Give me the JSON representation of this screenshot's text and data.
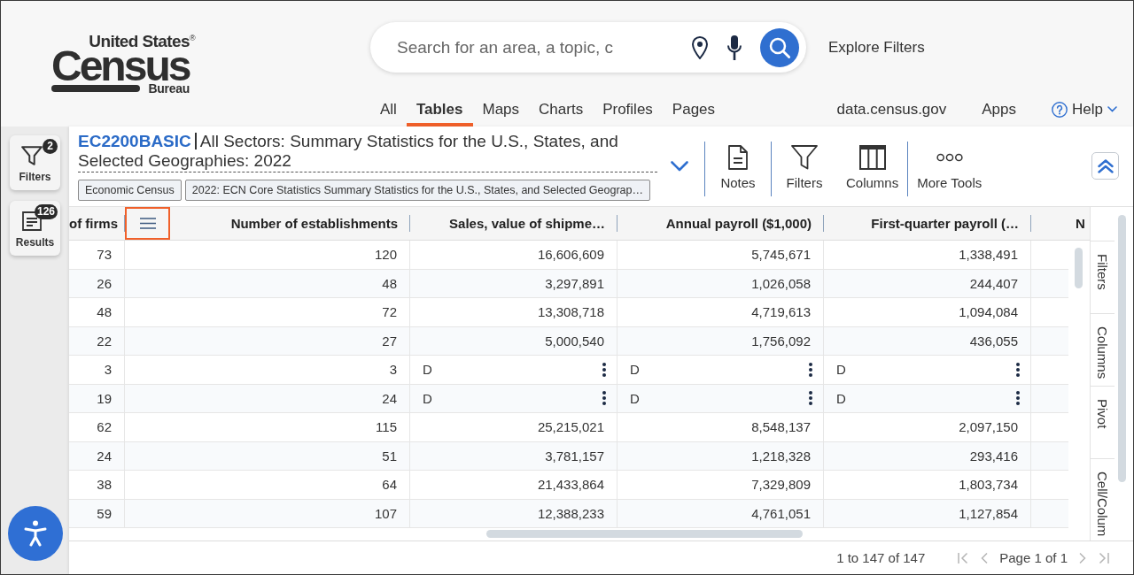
{
  "header": {
    "logo": {
      "top": "United States",
      "mark": "®",
      "main": "Census",
      "bottom": "Bureau"
    },
    "search": {
      "placeholder": "Search for an area, a topic, c"
    },
    "explore": "Explore Filters"
  },
  "nav": {
    "tabs": [
      {
        "label": "All",
        "selected": false
      },
      {
        "label": "Tables",
        "selected": true
      },
      {
        "label": "Maps",
        "selected": false
      },
      {
        "label": "Charts",
        "selected": false
      },
      {
        "label": "Profiles",
        "selected": false
      },
      {
        "label": "Pages",
        "selected": false
      }
    ],
    "links": [
      "data.census.gov",
      "Apps"
    ],
    "help": "Help"
  },
  "sidebar": {
    "buttons": [
      {
        "kind": "filters",
        "label": "Filters",
        "badge": "2"
      },
      {
        "kind": "results",
        "label": "Results",
        "badge": "126"
      }
    ]
  },
  "table_info": {
    "id": "EC2200BASIC",
    "title": "All Sectors: Summary Statistics for the U.S., States, and Selected Geographies: 2022",
    "tags": [
      "Economic Census",
      "2022: ECN Core Statistics Summary Statistics for the U.S., States, and Selected Geograp…"
    ]
  },
  "toolbar": {
    "groups": [
      [
        {
          "kind": "notes",
          "label": "Notes"
        }
      ],
      [
        {
          "kind": "filters",
          "label": "Filters"
        },
        {
          "kind": "columns",
          "label": "Columns"
        }
      ],
      [
        {
          "kind": "more",
          "label": "More Tools"
        }
      ]
    ]
  },
  "table": {
    "columns": [
      {
        "label": "of firms"
      },
      {
        "label": "Number of establishments",
        "menu": {
          "highlighted": true
        }
      },
      {
        "label": "Sales, value of shipme…"
      },
      {
        "label": "Annual payroll ($1,000)"
      },
      {
        "label": "First-quarter payroll (…"
      },
      {
        "label": "N"
      }
    ],
    "rows": [
      [
        {
          "text": "73",
          "kind": "number"
        },
        {
          "text": "120",
          "kind": "number"
        },
        {
          "text": "16,606,609",
          "kind": "number"
        },
        {
          "text": "5,745,671",
          "kind": "number"
        },
        {
          "text": "1,338,491",
          "kind": "number"
        }
      ],
      [
        {
          "text": "26",
          "kind": "number"
        },
        {
          "text": "48",
          "kind": "number"
        },
        {
          "text": "3,297,891",
          "kind": "number"
        },
        {
          "text": "1,026,058",
          "kind": "number"
        },
        {
          "text": "244,407",
          "kind": "number"
        }
      ],
      [
        {
          "text": "48",
          "kind": "number"
        },
        {
          "text": "72",
          "kind": "number"
        },
        {
          "text": "13,308,718",
          "kind": "number"
        },
        {
          "text": "4,719,613",
          "kind": "number"
        },
        {
          "text": "1,094,084",
          "kind": "number"
        }
      ],
      [
        {
          "text": "22",
          "kind": "number"
        },
        {
          "text": "27",
          "kind": "number"
        },
        {
          "text": "5,000,540",
          "kind": "number"
        },
        {
          "text": "1,756,092",
          "kind": "number"
        },
        {
          "text": "436,055",
          "kind": "number"
        }
      ],
      [
        {
          "text": "3",
          "kind": "number"
        },
        {
          "text": "3",
          "kind": "number"
        },
        {
          "text": "D",
          "kind": "flag"
        },
        {
          "text": "D",
          "kind": "flag"
        },
        {
          "text": "D",
          "kind": "flag"
        }
      ],
      [
        {
          "text": "19",
          "kind": "number"
        },
        {
          "text": "24",
          "kind": "number"
        },
        {
          "text": "D",
          "kind": "flag"
        },
        {
          "text": "D",
          "kind": "flag"
        },
        {
          "text": "D",
          "kind": "flag"
        }
      ],
      [
        {
          "text": "62",
          "kind": "number"
        },
        {
          "text": "115",
          "kind": "number"
        },
        {
          "text": "25,215,021",
          "kind": "number"
        },
        {
          "text": "8,548,137",
          "kind": "number"
        },
        {
          "text": "2,097,150",
          "kind": "number"
        }
      ],
      [
        {
          "text": "24",
          "kind": "number"
        },
        {
          "text": "51",
          "kind": "number"
        },
        {
          "text": "3,781,157",
          "kind": "number"
        },
        {
          "text": "1,218,328",
          "kind": "number"
        },
        {
          "text": "293,416",
          "kind": "number"
        }
      ],
      [
        {
          "text": "38",
          "kind": "number"
        },
        {
          "text": "64",
          "kind": "number"
        },
        {
          "text": "21,433,864",
          "kind": "number"
        },
        {
          "text": "7,329,809",
          "kind": "number"
        },
        {
          "text": "1,803,734",
          "kind": "number"
        }
      ],
      [
        {
          "text": "59",
          "kind": "number"
        },
        {
          "text": "107",
          "kind": "number"
        },
        {
          "text": "12,388,233",
          "kind": "number"
        },
        {
          "text": "4,761,051",
          "kind": "number"
        },
        {
          "text": "1,127,854",
          "kind": "number"
        }
      ]
    ]
  },
  "side_tabs": [
    "Filters",
    "Columns",
    "Pivot",
    "Cell/Colum"
  ],
  "pagination": {
    "range": "1 to 147 of 147",
    "page": "Page 1 of 1",
    "buttons": [
      {
        "kind": "first",
        "disabled": true
      },
      {
        "kind": "previous",
        "disabled": true
      },
      {
        "kind": "next",
        "disabled": true
      },
      {
        "kind": "last",
        "disabled": true
      }
    ]
  }
}
